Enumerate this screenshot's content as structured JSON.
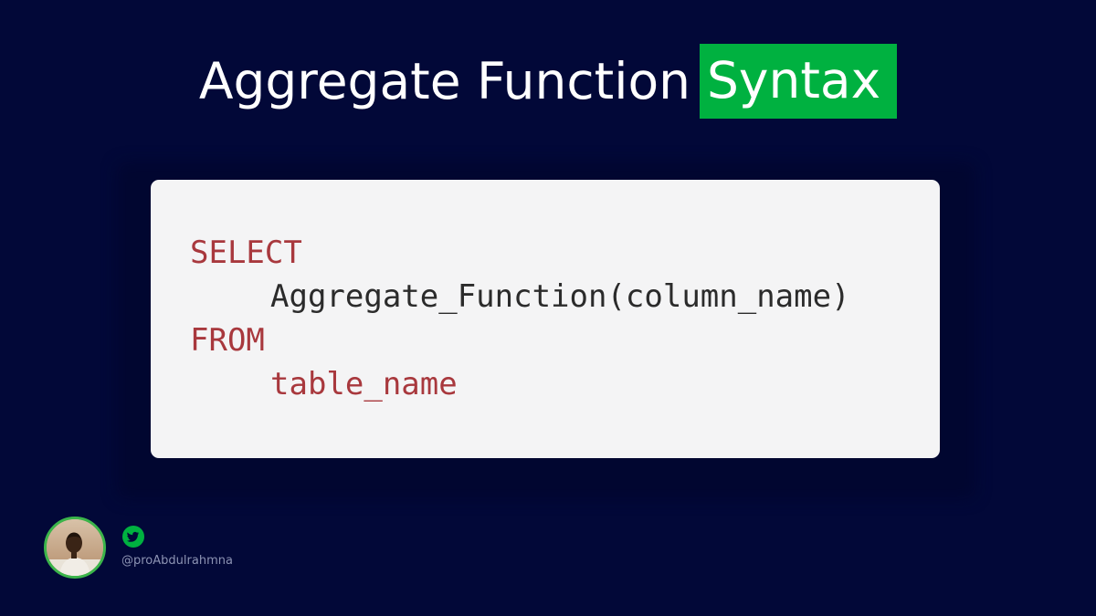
{
  "title": {
    "plain": "Aggregate Function",
    "highlight": "Syntax"
  },
  "code": {
    "lines": [
      "SELECT",
      "Aggregate_Function(column_name)",
      "FROM",
      "table_name"
    ]
  },
  "author": {
    "handle": "@proAbdulrahmna",
    "social_icon": "twitter-icon",
    "avatar_icon": "avatar"
  },
  "colors": {
    "background": "#020838",
    "highlight": "#00b140",
    "keyword": "#a8383d",
    "code_text": "#2b2b2b",
    "card": "#f4f4f5"
  }
}
